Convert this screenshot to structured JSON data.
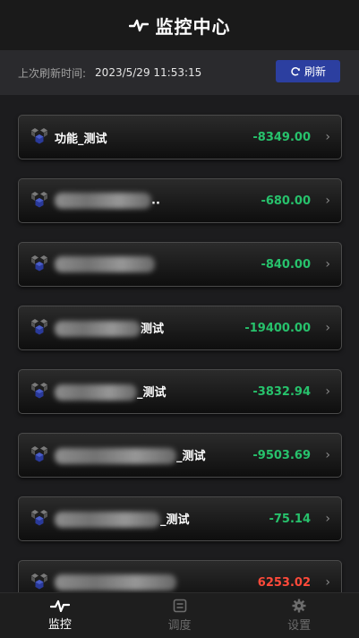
{
  "header": {
    "title": "监控中心",
    "icon": "pulse-icon"
  },
  "refresh": {
    "label": "上次刷新时间:",
    "time": "2023/5/29 11:53:15",
    "button_label": "刷新",
    "button_icon": "refresh-icon"
  },
  "accent": "#2c3fa0",
  "colors": {
    "positive": "#27c26c",
    "negative": "#ff4a3a"
  },
  "cards": [
    {
      "name_prefix": "",
      "name_suffix": "功能_测试",
      "value": "-8349.00",
      "status": "pos"
    },
    {
      "name_prefix": "",
      "name_suffix": "..",
      "value": "-680.00",
      "status": "pos"
    },
    {
      "name_prefix": "",
      "name_suffix": "",
      "value": "-840.00",
      "status": "pos"
    },
    {
      "name_prefix": "",
      "name_suffix": "测试",
      "value": "-19400.00",
      "status": "pos"
    },
    {
      "name_prefix": "",
      "name_suffix": "_测试",
      "value": "-3832.94",
      "status": "pos"
    },
    {
      "name_prefix": "",
      "name_suffix": "_测试",
      "value": "-9503.69",
      "status": "pos"
    },
    {
      "name_prefix": "",
      "name_suffix": "_测试",
      "value": "-75.14",
      "status": "pos"
    },
    {
      "name_prefix": "",
      "name_suffix": "",
      "value": "6253.02",
      "status": "neg"
    }
  ],
  "tabs": [
    {
      "label": "监控",
      "icon": "pulse-icon",
      "active": true
    },
    {
      "label": "调度",
      "icon": "schedule-icon",
      "active": false
    },
    {
      "label": "设置",
      "icon": "gear-icon",
      "active": false
    }
  ]
}
